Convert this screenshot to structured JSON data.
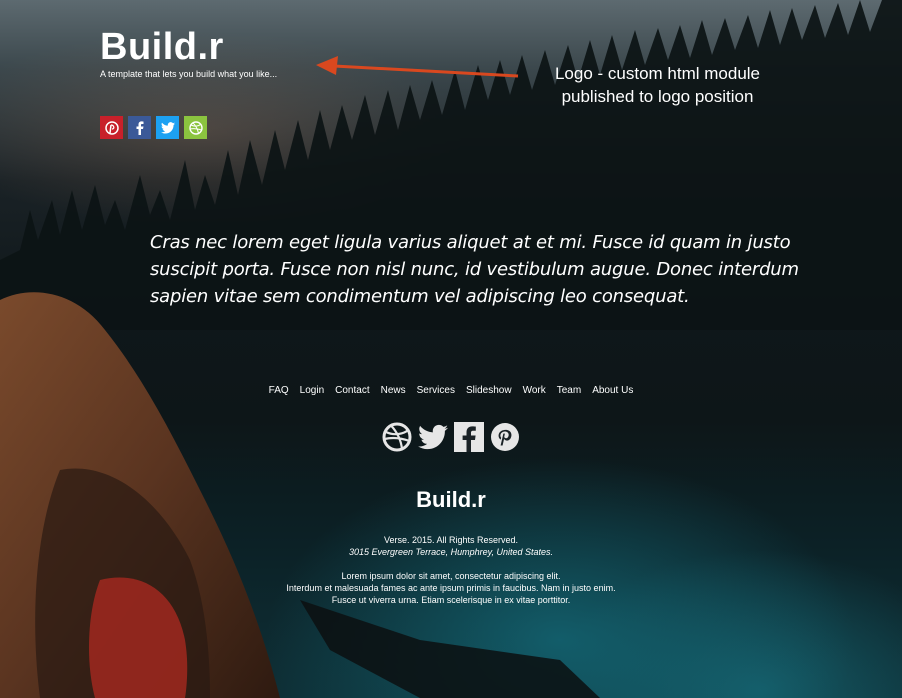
{
  "logo": {
    "title": "Build.r",
    "tagline": "A template that lets you build what you like..."
  },
  "social_top": [
    {
      "icon": "pinterest-icon",
      "color": "#c8202a"
    },
    {
      "icon": "facebook-icon",
      "color": "#3b5998"
    },
    {
      "icon": "twitter-icon",
      "color": "#1da1f2"
    },
    {
      "icon": "dribbble-icon",
      "color": "#8bc43f"
    }
  ],
  "annotation": {
    "line1": "Logo - custom html module",
    "line2": "published to logo position",
    "arrow_color": "#d9481f"
  },
  "quote": "Cras nec lorem eget ligula varius aliquet at et mi. Fusce id quam in justo suscipit porta. Fusce non nisl nunc, id vestibulum augue. Donec interdum sapien vitae sem condimentum vel adipiscing leo consequat.",
  "footer": {
    "nav": [
      "FAQ",
      "Login",
      "Contact",
      "News",
      "Services",
      "Slideshow",
      "Work",
      "Team",
      "About Us"
    ],
    "icons": [
      "dribbble-icon",
      "twitter-icon",
      "facebook-icon",
      "pinterest-icon"
    ],
    "title": "Build.r",
    "copyright": "Verse. 2015. All Rights Reserved.",
    "address": "3015 Evergreen Terrace, Humphrey, United States.",
    "lorem": [
      "Lorem ipsum dolor sit amet, consectetur adipiscing elit.",
      "Interdum et malesuada fames ac ante ipsum primis in faucibus. Nam in justo enim.",
      "Fusce ut viverra urna. Etiam scelerisque in ex vitae porttitor."
    ]
  }
}
